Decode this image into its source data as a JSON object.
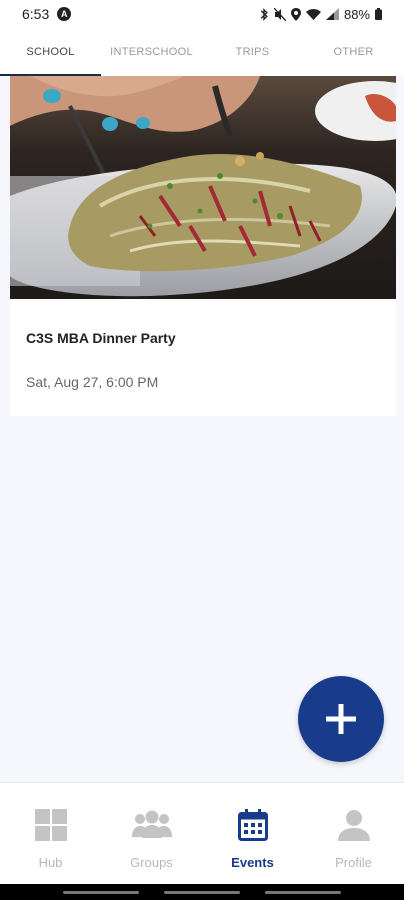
{
  "status": {
    "time": "6:53",
    "battery": "88%"
  },
  "tabs": [
    {
      "label": "SCHOOL",
      "active": true
    },
    {
      "label": "INTERSCHOOL",
      "active": false
    },
    {
      "label": "TRIPS",
      "active": false
    },
    {
      "label": "OTHER",
      "active": false
    }
  ],
  "events": [
    {
      "title": "C3S MBA Dinner Party",
      "date": "Sat, Aug 27, 6:00 PM"
    }
  ],
  "nav": [
    {
      "label": "Hub",
      "icon": "hub-grid-icon",
      "active": false
    },
    {
      "label": "Groups",
      "icon": "groups-icon",
      "active": false
    },
    {
      "label": "Events",
      "icon": "calendar-icon",
      "active": true
    },
    {
      "label": "Profile",
      "icon": "profile-icon",
      "active": false
    }
  ],
  "colors": {
    "accent": "#183b8c",
    "background": "#f5f7fc",
    "inactive": "#b8b8b8"
  }
}
